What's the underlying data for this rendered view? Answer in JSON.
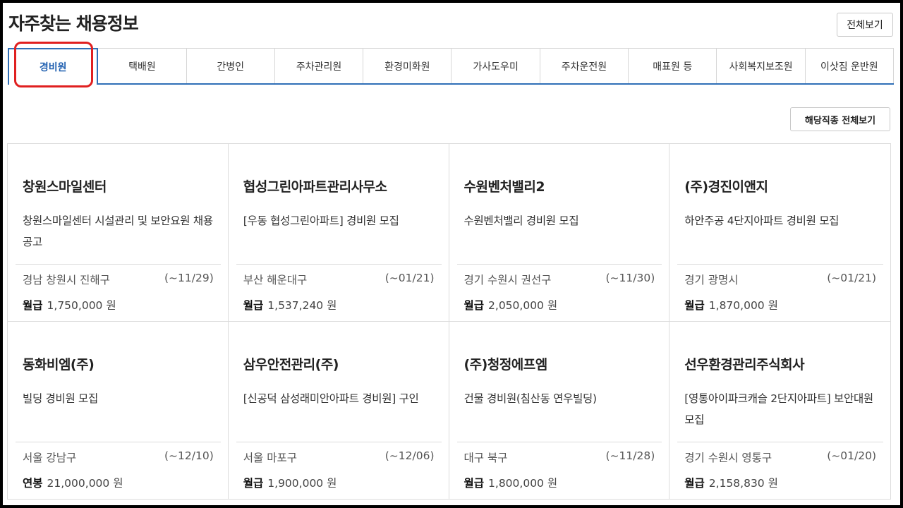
{
  "header": {
    "title": "자주찾는 채용정보",
    "view_all_label": "전체보기"
  },
  "tabs": [
    {
      "label": "경비원",
      "active": true
    },
    {
      "label": "택배원",
      "active": false
    },
    {
      "label": "간병인",
      "active": false
    },
    {
      "label": "주차관리원",
      "active": false
    },
    {
      "label": "환경미화원",
      "active": false
    },
    {
      "label": "가사도우미",
      "active": false
    },
    {
      "label": "주차운전원",
      "active": false
    },
    {
      "label": "매표원 등",
      "active": false
    },
    {
      "label": "사회복지보조원",
      "active": false
    },
    {
      "label": "이삿짐 운반원",
      "active": false
    }
  ],
  "category_view_all_label": "해당직종 전체보기",
  "jobs": [
    {
      "company": "창원스마일센터",
      "title": "창원스마일센터 시설관리 및 보안요원 채용 공고",
      "location": "경남 창원시 진해구",
      "deadline": "(~11/29)",
      "pay_type": "월급",
      "pay": "1,750,000 원"
    },
    {
      "company": "협성그린아파트관리사무소",
      "title": "[우동 협성그린아파트] 경비원 모집",
      "location": "부산 해운대구",
      "deadline": "(~01/21)",
      "pay_type": "월급",
      "pay": "1,537,240 원"
    },
    {
      "company": "수원벤처밸리2",
      "title": "수원벤처밸리 경비원 모집",
      "location": "경기 수원시 권선구",
      "deadline": "(~11/30)",
      "pay_type": "월급",
      "pay": "2,050,000 원"
    },
    {
      "company": "(주)경진이앤지",
      "title": "하안주공 4단지아파트 경비원 모집",
      "location": "경기 광명시",
      "deadline": "(~01/21)",
      "pay_type": "월급",
      "pay": "1,870,000 원"
    },
    {
      "company": "동화비엠(주)",
      "title": "빌딩 경비원 모집",
      "location": "서울 강남구",
      "deadline": "(~12/10)",
      "pay_type": "연봉",
      "pay": "21,000,000 원"
    },
    {
      "company": "삼우안전관리(주)",
      "title": "[신공덕 삼성래미안아파트 경비원] 구인",
      "location": "서울 마포구",
      "deadline": "(~12/06)",
      "pay_type": "월급",
      "pay": "1,900,000 원"
    },
    {
      "company": "(주)청정에프엠",
      "title": "건물 경비원(침산동 연우빌딩)",
      "location": "대구 북구",
      "deadline": "(~11/28)",
      "pay_type": "월급",
      "pay": "1,800,000 원"
    },
    {
      "company": "선우환경관리주식회사",
      "title": "[영통아이파크캐슬 2단지아파트] 보안대원 모집",
      "location": "경기 수원시 영통구",
      "deadline": "(~01/20)",
      "pay_type": "월급",
      "pay": "2,158,830 원"
    }
  ],
  "colors": {
    "accent": "#2f6fb7",
    "highlight": "#e02020"
  }
}
